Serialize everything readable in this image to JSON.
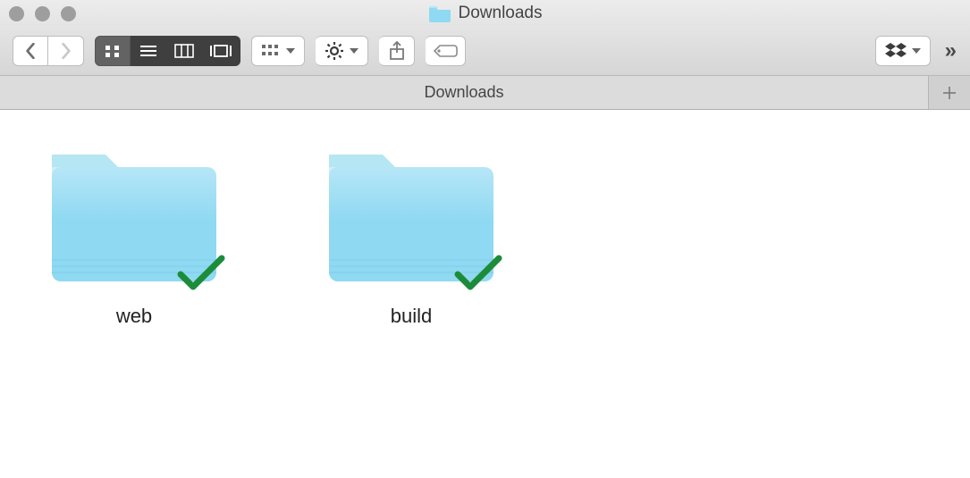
{
  "window": {
    "title": "Downloads"
  },
  "tabbar": {
    "tabs": [
      {
        "label": "Downloads"
      }
    ]
  },
  "items": [
    {
      "name": "web",
      "synced": true
    },
    {
      "name": "build",
      "synced": true
    }
  ]
}
